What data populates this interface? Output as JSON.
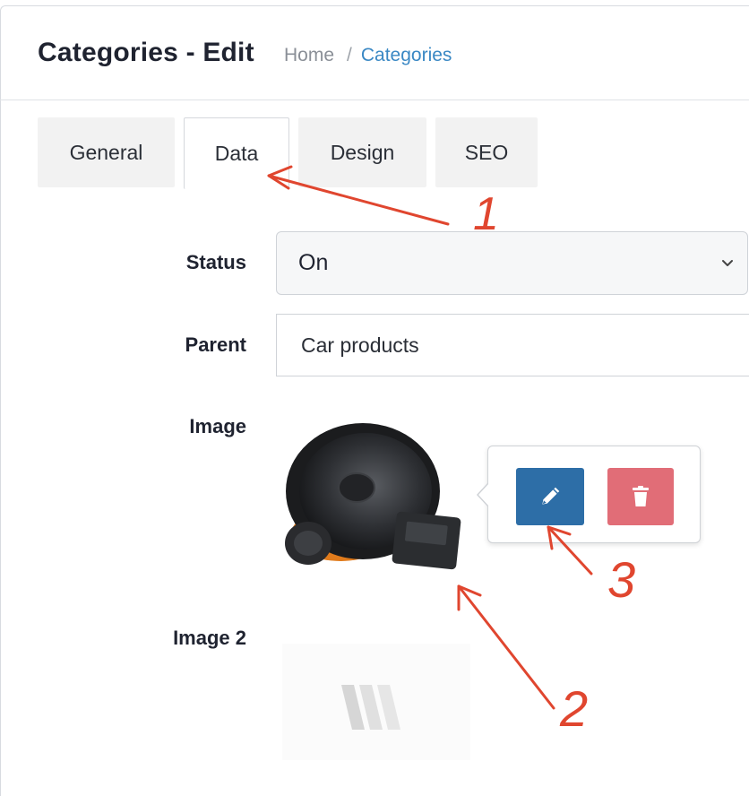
{
  "header": {
    "title": "Categories - Edit",
    "breadcrumb": {
      "home": "Home",
      "separator": "/",
      "current": "Categories"
    }
  },
  "tabs": [
    {
      "label": "General",
      "active": false
    },
    {
      "label": "Data",
      "active": true
    },
    {
      "label": "Design",
      "active": false
    },
    {
      "label": "SEO",
      "active": false
    }
  ],
  "form": {
    "status": {
      "label": "Status",
      "value": "On"
    },
    "parent": {
      "label": "Parent",
      "value": "Car products"
    },
    "image": {
      "label": "Image"
    },
    "image2": {
      "label": "Image 2"
    }
  },
  "popover": {
    "edit_icon": "pencil-icon",
    "delete_icon": "trash-icon"
  },
  "annotations": {
    "marker_1": "1",
    "marker_2": "2",
    "marker_3": "3",
    "color": "#e0462f"
  },
  "colors": {
    "link": "#3a88c4",
    "edit_button": "#2d6ea7",
    "delete_button": "#e16d77"
  }
}
